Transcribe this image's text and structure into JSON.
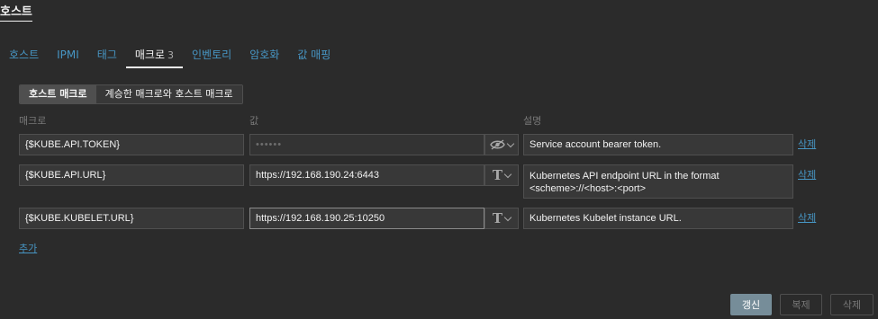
{
  "page": {
    "title": "호스트"
  },
  "tabs": [
    {
      "label": "호스트"
    },
    {
      "label": "IPMI"
    },
    {
      "label": "태그"
    },
    {
      "label": "매크로",
      "count": "3"
    },
    {
      "label": "인벤토리"
    },
    {
      "label": "암호화"
    },
    {
      "label": "값 매핑"
    }
  ],
  "macro_mode": {
    "host": "호스트 매크로",
    "inherited": "계승한 매크로와 호스트 매크로"
  },
  "columns": {
    "macro": "매크로",
    "value": "값",
    "description": "설명"
  },
  "rows": [
    {
      "macro": "{$KUBE.API.TOKEN}",
      "value": "••••••",
      "value_type_icon": "eye-slash-icon",
      "description": "Service account bearer token.",
      "remove": "삭제"
    },
    {
      "macro": "{$KUBE.API.URL}",
      "value": "https://192.168.190.24:6443",
      "value_type_icon": "text-type-icon",
      "description": "Kubernetes API endpoint URL in the format <scheme>://<host>:<port>",
      "remove": "삭제"
    },
    {
      "macro": "{$KUBE.KUBELET.URL}",
      "value": "https://192.168.190.25:10250",
      "value_type_icon": "text-type-icon",
      "description": "Kubernetes Kubelet instance URL.",
      "remove": "삭제"
    }
  ],
  "add_link": "추가",
  "buttons": {
    "update": "갱신",
    "clone": "복제",
    "delete": "삭제"
  },
  "colors": {
    "link": "#4796c4",
    "primary_button": "#768d99",
    "background": "#2b2b2b"
  }
}
